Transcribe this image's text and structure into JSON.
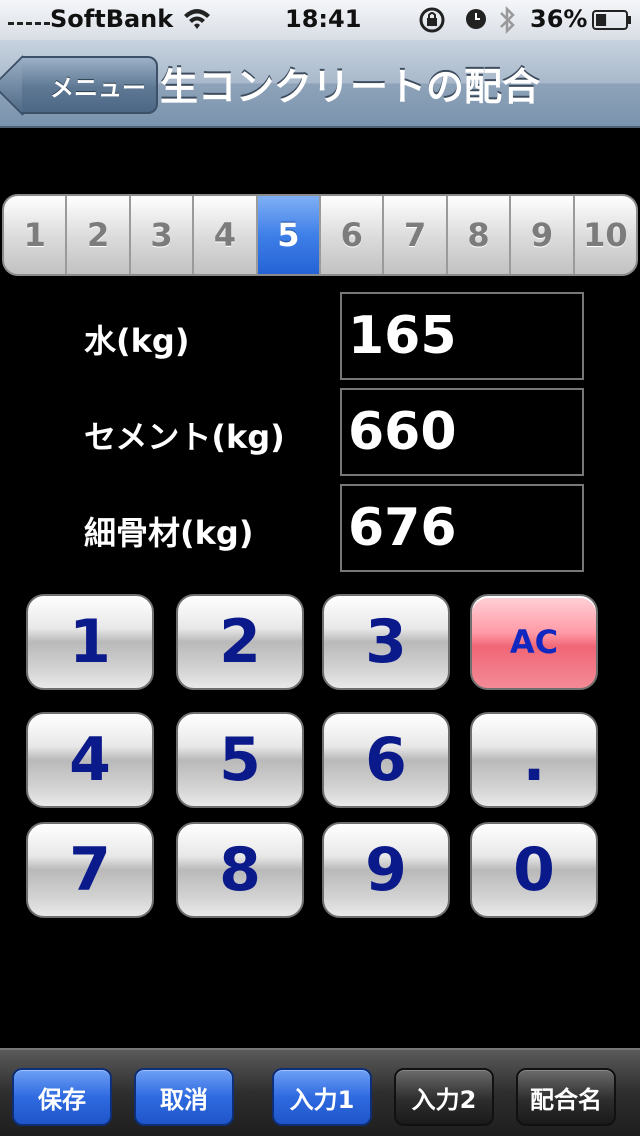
{
  "status_bar": {
    "carrier": "SoftBank",
    "time": "18:41",
    "battery": "36%",
    "battery_level": 0.36,
    "icons": [
      "signal-icon",
      "wifi-icon",
      "rotation-lock-icon",
      "alarm-icon",
      "bluetooth-icon",
      "battery-icon"
    ]
  },
  "nav": {
    "back_label": "メニュー",
    "title": "生コンクリートの配合"
  },
  "segments": {
    "items": [
      "1",
      "2",
      "3",
      "4",
      "5",
      "6",
      "7",
      "8",
      "9",
      "10"
    ],
    "selected": "5"
  },
  "fields": [
    {
      "label": "水(kg)",
      "value": "165"
    },
    {
      "label": "セメント(kg)",
      "value": "660"
    },
    {
      "label": "細骨材(kg)",
      "value": "676"
    }
  ],
  "keypad": {
    "keys": [
      "1",
      "2",
      "3",
      "AC",
      "4",
      "5",
      "6",
      ".",
      "7",
      "8",
      "9",
      "0"
    ]
  },
  "toolbar": {
    "buttons": [
      "保存",
      "取消",
      "入力1",
      "入力2",
      "配合名"
    ]
  },
  "colors": {
    "selected_segment": "#3f7fe8",
    "key_text": "#0b1a8a",
    "ac_key": "#f06676",
    "toolbar_blue": "#2f6ae0"
  }
}
